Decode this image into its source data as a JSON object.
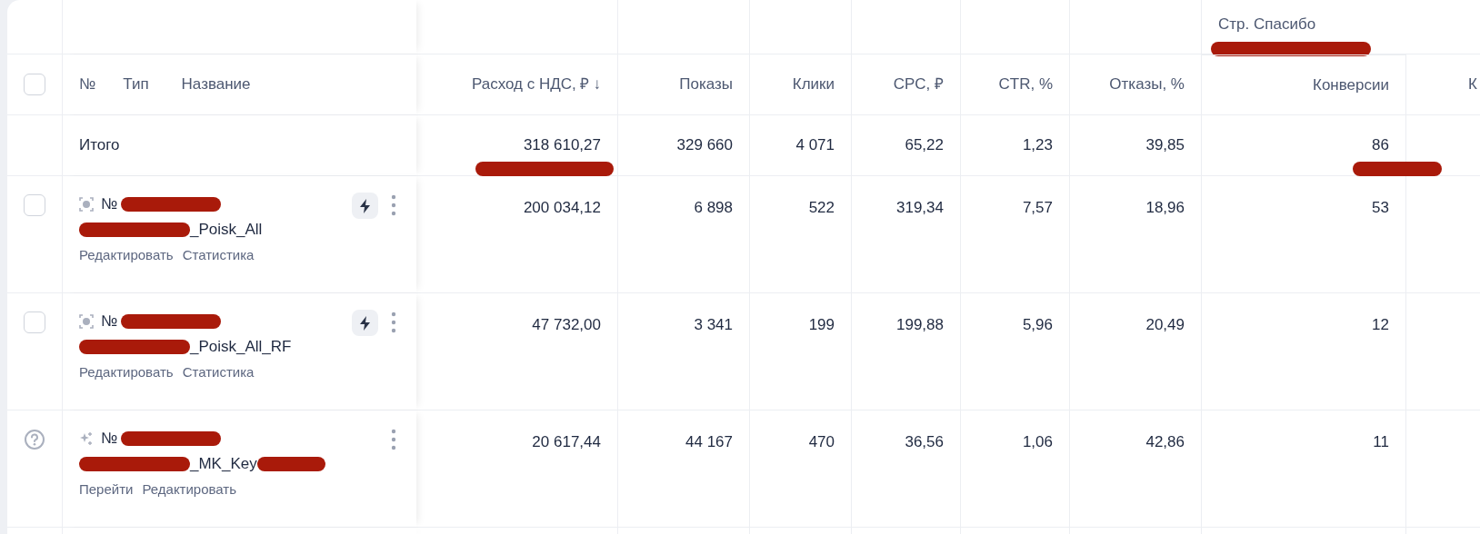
{
  "group_header": {
    "label": "Стр. Спасибо",
    "redacted": true
  },
  "select_all": {
    "checked": false
  },
  "name_column_labels": [
    "№",
    "Тип",
    "Название"
  ],
  "metric_columns": [
    {
      "label": "Расход с НДС, ₽",
      "sort": "↓"
    },
    {
      "label": "Показы"
    },
    {
      "label": "Клики"
    },
    {
      "label": "CPC, ₽"
    },
    {
      "label": "CTR, %"
    },
    {
      "label": "Отказы, %"
    },
    {
      "label": "Конверсии"
    },
    {
      "label": "К"
    }
  ],
  "totals": {
    "label": "Итого",
    "values": [
      {
        "text": "318 610,27",
        "redacted": true
      },
      {
        "text": "329 660"
      },
      {
        "text": "4 071"
      },
      {
        "text": "65,22"
      },
      {
        "text": "1,23"
      },
      {
        "text": "39,85"
      },
      {
        "text": "86",
        "redacted": true
      }
    ]
  },
  "rows": [
    {
      "selector": {
        "kind": "checkbox",
        "checked": false
      },
      "status": {
        "kind": "target"
      },
      "number_prefix": "№",
      "number_redacted": true,
      "name": "_Poisk_All",
      "name_prefix_redacted": true,
      "name_suffix_redacted": false,
      "fast_button": true,
      "actions": [
        "Редактировать",
        "Статистика"
      ],
      "values": [
        "200 034,12",
        "6 898",
        "522",
        "319,34",
        "7,57",
        "18,96",
        "53"
      ]
    },
    {
      "selector": {
        "kind": "checkbox",
        "checked": false
      },
      "status": {
        "kind": "target"
      },
      "number_prefix": "№",
      "number_redacted": true,
      "name": "_Poisk_All_RF",
      "name_prefix_redacted": true,
      "name_suffix_redacted": false,
      "fast_button": true,
      "actions": [
        "Редактировать",
        "Статистика"
      ],
      "values": [
        "47 732,00",
        "3 341",
        "199",
        "199,88",
        "5,96",
        "20,49",
        "12"
      ]
    },
    {
      "selector": {
        "kind": "help"
      },
      "status": {
        "kind": "sparkle"
      },
      "number_prefix": "№",
      "number_redacted": true,
      "name": "_MK_Key",
      "name_prefix_redacted": true,
      "name_suffix_redacted": true,
      "fast_button": false,
      "actions": [
        "Перейти",
        "Редактировать"
      ],
      "values": [
        "20 617,44",
        "44 167",
        "470",
        "36,56",
        "1,06",
        "42,86",
        "11"
      ]
    }
  ]
}
